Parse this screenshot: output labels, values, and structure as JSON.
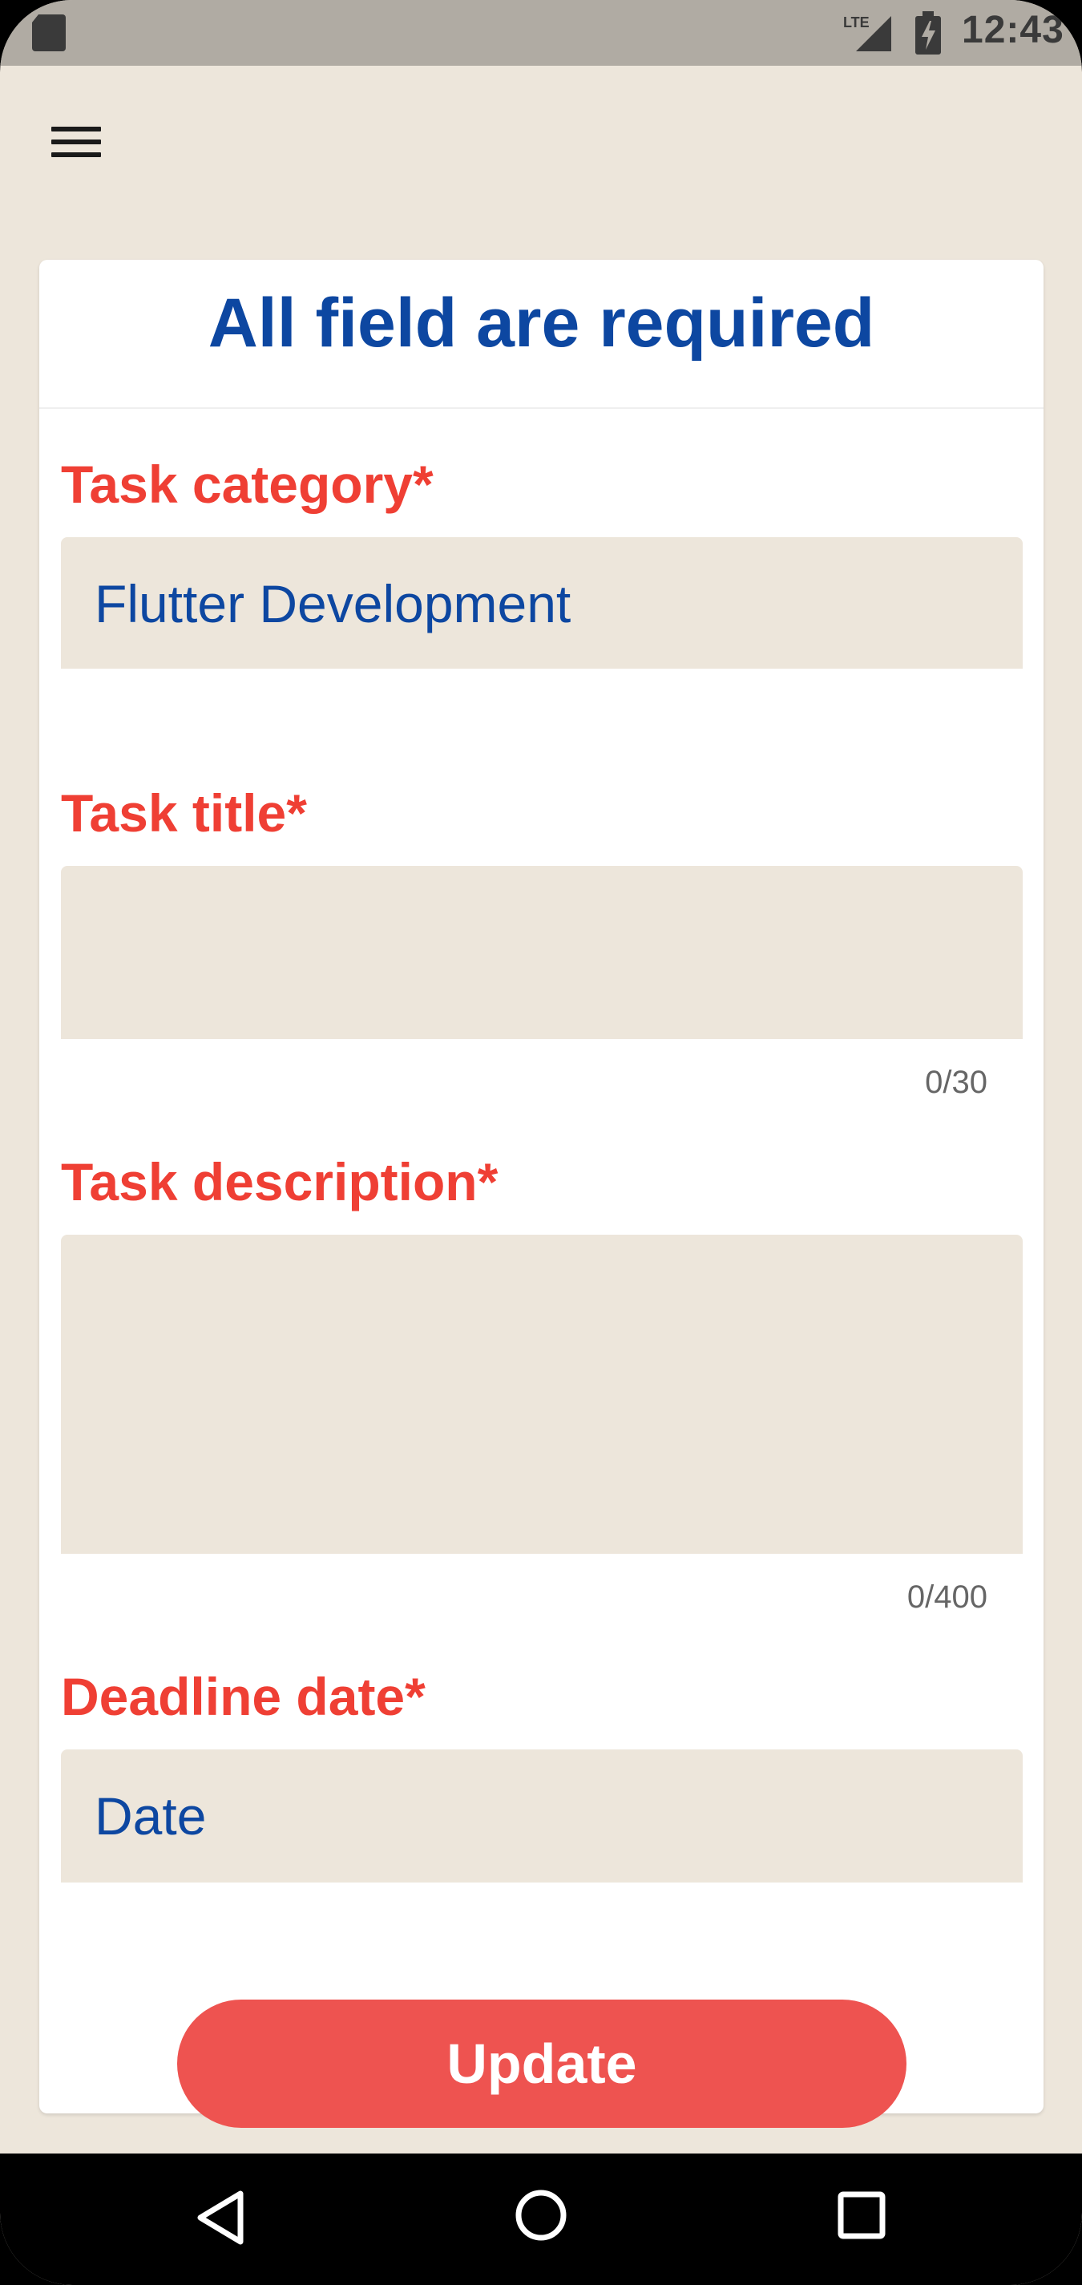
{
  "status_bar": {
    "time": "12:43",
    "network": "LTE",
    "icons": [
      "sd-card-icon",
      "lte-signal-icon",
      "battery-charging-icon"
    ]
  },
  "app_bar": {
    "menu_icon": "hamburger-menu-icon"
  },
  "form": {
    "title": "All field are required",
    "category": {
      "label": "Task category*",
      "value": "Flutter Development"
    },
    "task_title": {
      "label": "Task title*",
      "value": "",
      "counter": "0/30"
    },
    "description": {
      "label": "Task description*",
      "value": "",
      "counter": "0/400"
    },
    "deadline": {
      "label": "Deadline date*",
      "value": "Date"
    },
    "submit_label": "Update"
  },
  "nav_bar": {
    "icons": [
      "back-triangle-icon",
      "home-circle-icon",
      "recents-square-icon"
    ]
  },
  "colors": {
    "background": "#ede6db",
    "title_blue": "#0d47a1",
    "label_red": "#ef3f34",
    "button_red": "#ee5350",
    "status_bar": "#b0aba3"
  }
}
